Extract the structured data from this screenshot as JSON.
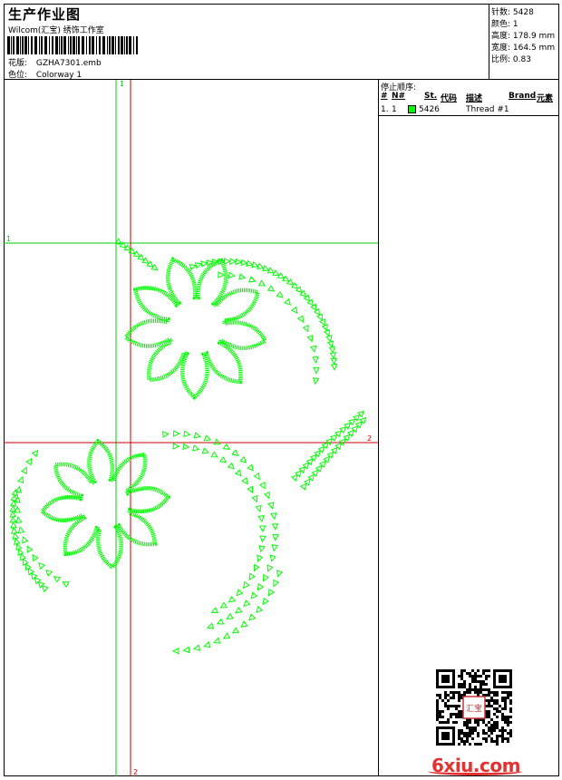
{
  "header": {
    "title": "生产作业图",
    "subtitle": "Wilcom(汇宝) 绣饰工作室",
    "design_label": "花版:",
    "design_value": "GZHA7301.emb",
    "colorway_label": "色位:",
    "colorway_value": "Colorway 1"
  },
  "stats": [
    {
      "label": "针数:",
      "value": "5428"
    },
    {
      "label": "颜色:",
      "value": "1"
    },
    {
      "label": "高度:",
      "value": "178.9 mm"
    },
    {
      "label": "宽度:",
      "value": "164.5 mm"
    },
    {
      "label": "比例:",
      "value": "0.83"
    }
  ],
  "stop_sequence": {
    "title": "停止顺序:",
    "columns": [
      "#",
      "N#",
      "St.",
      "代码",
      "描述",
      "Brand",
      "元素"
    ],
    "rows": [
      {
        "index": "1.",
        "n": "1",
        "color": "#00ff00",
        "code": "5426",
        "description": "Thread #1"
      }
    ]
  },
  "guides": {
    "vertical_green_label": "1",
    "horizontal_green_label": "1",
    "horizontal_red_label": "2",
    "vertical_red_label": "2"
  },
  "colors": {
    "thread": "#00ff00",
    "guide_green": "#00cc00",
    "guide_red": "#cc0000",
    "watermark": "#e23232"
  },
  "watermark": "6xiu.com",
  "seal_text": "汇宝"
}
